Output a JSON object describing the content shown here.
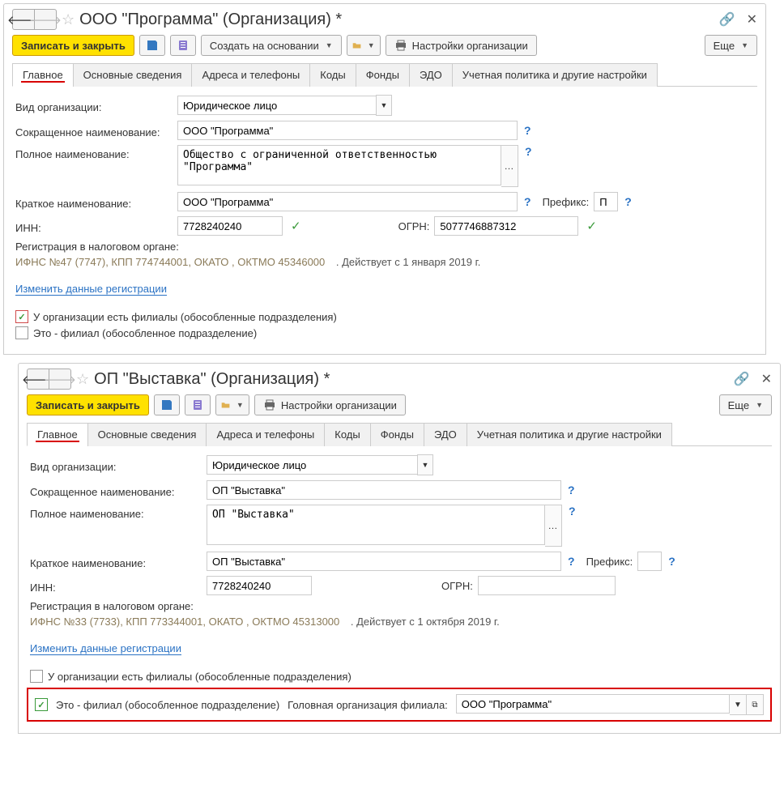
{
  "w1": {
    "title": "ООО \"Программа\" (Организация) *",
    "toolbar": {
      "save_close": "Записать и закрыть",
      "create_based": "Создать на основании",
      "org_settings": "Настройки организации",
      "more": "Еще"
    },
    "tabs": [
      "Главное",
      "Основные сведения",
      "Адреса и телефоны",
      "Коды",
      "Фонды",
      "ЭДО",
      "Учетная политика и другие настройки"
    ],
    "labels": {
      "org_type": "Вид организации:",
      "short_name": "Сокращенное наименование:",
      "full_name": "Полное наименование:",
      "brief_name": "Краткое наименование:",
      "prefix": "Префикс:",
      "inn": "ИНН:",
      "ogrn": "ОГРН:",
      "reg_header": "Регистрация в налоговом органе:",
      "change_reg": "Изменить данные регистрации",
      "cb_has_branches": "У организации есть филиалы (обособленные подразделения)",
      "cb_is_branch": "Это - филиал (обособленное подразделение)"
    },
    "values": {
      "org_type": "Юридическое лицо",
      "short_name": "ООО \"Программа\"",
      "full_name": "Общество с ограниченной ответственностью \"Программа\"",
      "brief_name": "ООО \"Программа\"",
      "prefix": "П",
      "inn": "7728240240",
      "ogrn": "5077746887312",
      "reg_text": "ИФНС №47 (7747), КПП 774744001, ОКАТО , ОКТМО 45346000",
      "reg_date": ". Действует с 1 января 2019 г."
    }
  },
  "w2": {
    "title": "ОП \"Выставка\" (Организация) *",
    "toolbar": {
      "save_close": "Записать и закрыть",
      "org_settings": "Настройки организации",
      "more": "Еще"
    },
    "tabs": [
      "Главное",
      "Основные сведения",
      "Адреса и телефоны",
      "Коды",
      "Фонды",
      "ЭДО",
      "Учетная политика и другие настройки"
    ],
    "labels": {
      "org_type": "Вид организации:",
      "short_name": "Сокращенное наименование:",
      "full_name": "Полное наименование:",
      "brief_name": "Краткое наименование:",
      "prefix": "Префикс:",
      "inn": "ИНН:",
      "ogrn": "ОГРН:",
      "reg_header": "Регистрация в налоговом органе:",
      "change_reg": "Изменить данные регистрации",
      "cb_has_branches": "У организации есть филиалы (обособленные подразделения)",
      "cb_is_branch": "Это - филиал (обособленное подразделение)",
      "parent_org": "Головная организация филиала:"
    },
    "values": {
      "org_type": "Юридическое лицо",
      "short_name": "ОП \"Выставка\"",
      "full_name": "ОП \"Выставка\"",
      "brief_name": "ОП \"Выставка\"",
      "prefix": "",
      "inn": "7728240240",
      "ogrn": "",
      "reg_text": "ИФНС №33 (7733), КПП 773344001, ОКАТО , ОКТМО 45313000",
      "reg_date": ". Действует с 1 октября 2019 г.",
      "parent_org": "ООО \"Программа\""
    }
  }
}
